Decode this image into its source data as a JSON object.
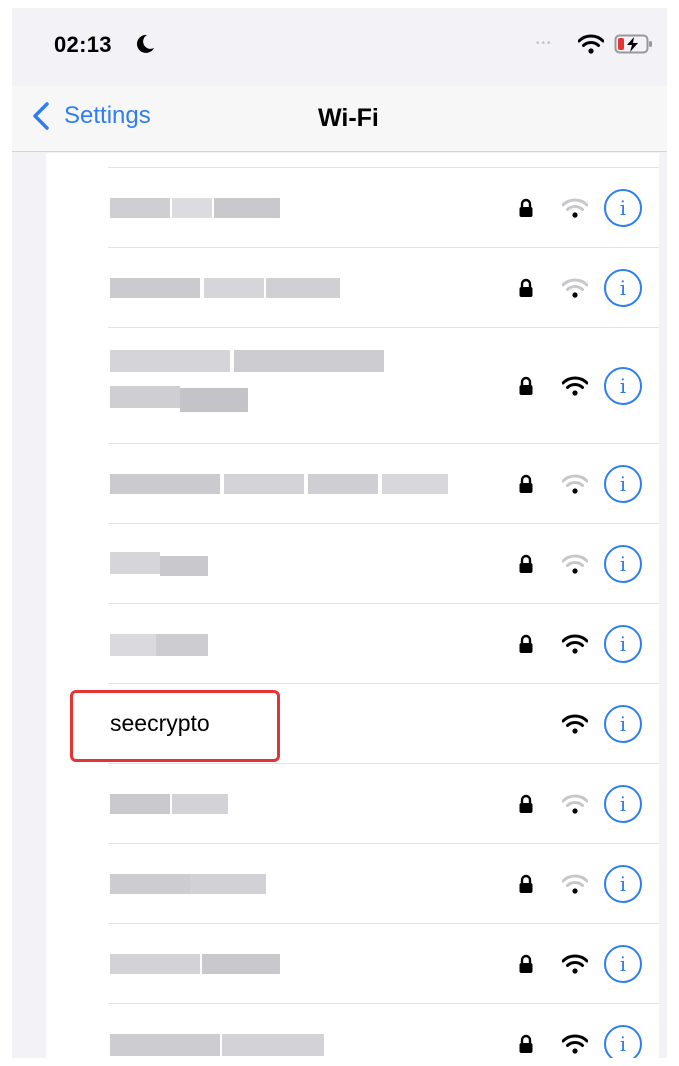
{
  "status_bar": {
    "time": "02:13",
    "focus_icon": "moon-icon",
    "wifi_icon": "wifi-icon",
    "battery_icon": "battery-charging-icon"
  },
  "nav": {
    "back_label": "Settings",
    "title": "Wi-Fi"
  },
  "networks": [
    {
      "ssid": "",
      "obscured": true,
      "locked": true,
      "signal": "weak"
    },
    {
      "ssid": "",
      "obscured": true,
      "locked": true,
      "signal": "weak"
    },
    {
      "ssid": "",
      "obscured": true,
      "locked": true,
      "signal": "strong"
    },
    {
      "ssid": "",
      "obscured": true,
      "locked": true,
      "signal": "weak"
    },
    {
      "ssid": "",
      "obscured": true,
      "locked": true,
      "signal": "weak"
    },
    {
      "ssid": "",
      "obscured": true,
      "locked": true,
      "signal": "strong"
    },
    {
      "ssid": "seecrypto",
      "obscured": false,
      "locked": false,
      "signal": "strong",
      "highlighted": true
    },
    {
      "ssid": "",
      "obscured": true,
      "locked": true,
      "signal": "weak"
    },
    {
      "ssid": "",
      "obscured": true,
      "locked": true,
      "signal": "weak"
    },
    {
      "ssid": "",
      "obscured": true,
      "locked": true,
      "signal": "strong"
    },
    {
      "ssid": "",
      "obscured": true,
      "locked": true,
      "signal": "strong"
    }
  ],
  "colors": {
    "accent": "#2f7ef0",
    "highlight": "#e43434"
  }
}
